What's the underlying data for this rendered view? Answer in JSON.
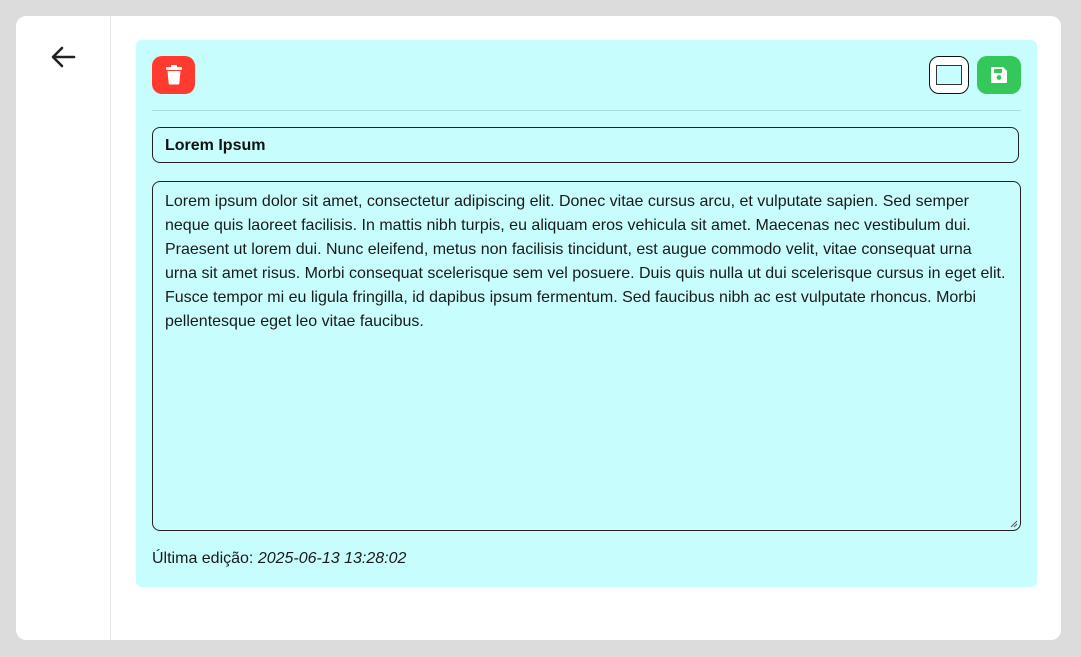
{
  "note": {
    "title": "Lorem Ipsum",
    "body": "Lorem ipsum dolor sit amet, consectetur adipiscing elit. Donec vitae cursus arcu, et vulputate sapien. Sed semper neque quis laoreet facilisis. In mattis nibh turpis, eu aliquam eros vehicula sit amet. Maecenas nec vestibulum dui. Praesent ut lorem dui. Nunc eleifend, metus non facilisis tincidunt, est augue commodo velit, vitae consequat urna urna sit amet risus. Morbi consequat scelerisque sem vel posuere. Duis quis nulla ut dui scelerisque cursus in eget elit. Fusce tempor mi eu ligula fringilla, id dapibus ipsum fermentum. Sed faucibus nibh ac est vulputate rhoncus. Morbi pellentesque eget leo vitae faucibus.",
    "last_edit_label": "Última edição:",
    "last_edit_value": "2025-06-13 13:28:02",
    "color": "#c7fdfd"
  },
  "icons": {
    "back": "arrow-left-icon",
    "delete": "trash-icon",
    "save": "floppy-disk-icon"
  },
  "colors": {
    "delete_button": "#ff3b30",
    "save_button": "#34c759",
    "panel_background": "#c7fdfd",
    "page_background": "#dcdcdc"
  }
}
